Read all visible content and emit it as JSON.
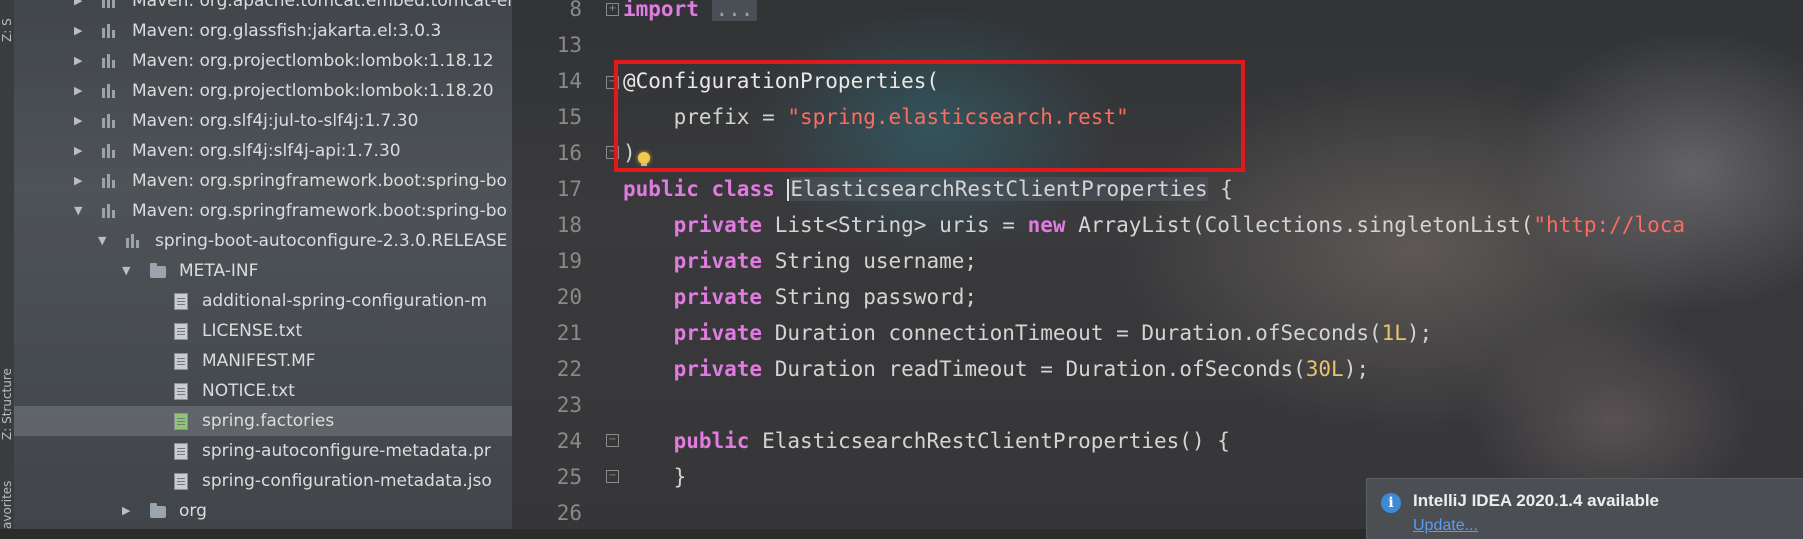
{
  "left_strip": {
    "top_label": "Z: S",
    "mid_label": "Z: Structure",
    "bottom_label": "avorites"
  },
  "project_tree": {
    "rows": [
      {
        "label": "Maven: org.apache.tomcat.embed:tomcat-em",
        "depth": 0,
        "expanded": false,
        "icon": "library-icon"
      },
      {
        "label": "Maven: org.glassfish:jakarta.el:3.0.3",
        "depth": 0,
        "expanded": false,
        "icon": "library-icon"
      },
      {
        "label": "Maven: org.projectlombok:lombok:1.18.12",
        "depth": 0,
        "expanded": false,
        "icon": "library-icon"
      },
      {
        "label": "Maven: org.projectlombok:lombok:1.18.20",
        "depth": 0,
        "expanded": false,
        "icon": "library-icon"
      },
      {
        "label": "Maven: org.slf4j:jul-to-slf4j:1.7.30",
        "depth": 0,
        "expanded": false,
        "icon": "library-icon"
      },
      {
        "label": "Maven: org.slf4j:slf4j-api:1.7.30",
        "depth": 0,
        "expanded": false,
        "icon": "library-icon"
      },
      {
        "label": "Maven: org.springframework.boot:spring-bo",
        "depth": 0,
        "expanded": false,
        "icon": "library-icon"
      },
      {
        "label": "Maven: org.springframework.boot:spring-bo",
        "depth": 0,
        "expanded": true,
        "icon": "library-icon"
      },
      {
        "label": "spring-boot-autoconfigure-2.3.0.RELEASE",
        "depth": 1,
        "expanded": true,
        "icon": "jar-icon"
      },
      {
        "label": "META-INF",
        "depth": 2,
        "expanded": true,
        "icon": "folder-icon"
      },
      {
        "label": "additional-spring-configuration-m",
        "depth": 3,
        "icon": "json-file-icon"
      },
      {
        "label": "LICENSE.txt",
        "depth": 3,
        "icon": "text-file-icon"
      },
      {
        "label": "MANIFEST.MF",
        "depth": 3,
        "icon": "manifest-file-icon"
      },
      {
        "label": "NOTICE.txt",
        "depth": 3,
        "icon": "text-file-icon"
      },
      {
        "label": "spring.factories",
        "depth": 3,
        "icon": "spring-file-icon",
        "selected": true
      },
      {
        "label": "spring-autoconfigure-metadata.pr",
        "depth": 3,
        "icon": "properties-file-icon"
      },
      {
        "label": "spring-configuration-metadata.jso",
        "depth": 3,
        "icon": "json-file-icon"
      },
      {
        "label": "org",
        "depth": 2,
        "expanded": false,
        "icon": "folder-icon"
      }
    ]
  },
  "editor": {
    "lines": [
      {
        "n": "8",
        "code": "import_line"
      },
      {
        "n": "13"
      },
      {
        "n": "14"
      },
      {
        "n": "15"
      },
      {
        "n": "16"
      },
      {
        "n": "17"
      },
      {
        "n": "18"
      },
      {
        "n": "19"
      },
      {
        "n": "20"
      },
      {
        "n": "21"
      },
      {
        "n": "22"
      },
      {
        "n": "23"
      },
      {
        "n": "24"
      },
      {
        "n": "25"
      },
      {
        "n": "26"
      }
    ],
    "tokens": {
      "import_kw": "import",
      "import_dots": "...",
      "annotation": "@ConfigurationProperties(",
      "prefix_key": "    prefix = ",
      "prefix_value": "\"spring.elasticsearch.rest\"",
      "close_paren": ")",
      "public_kw": "public",
      "class_kw": "class",
      "class_name": "ElasticsearchRestClientProperties",
      "open_brace": " {",
      "private_kw": "private",
      "uris_decl": " List<String> uris = ",
      "new_kw": "new",
      "uris_rest": " ArrayList(Collections.singletonList(",
      "uris_str": "\"http://loca",
      "username_decl": " String username;",
      "password_decl": " String password;",
      "conn_decl": " Duration connectionTimeout = Duration.ofSeconds(",
      "conn_num": "1L",
      "conn_end": ");",
      "read_decl": " Duration readTimeout = Duration.ofSeconds(",
      "read_num": "30L",
      "read_end": ");",
      "ctor_public": "public",
      "ctor_sig": " ElasticsearchRestClientProperties() {",
      "ctor_close": "}"
    }
  },
  "notification": {
    "title": "IntelliJ IDEA 2020.1.4 available",
    "link": "Update..."
  },
  "colors": {
    "keyword": "#e07be0",
    "string": "#ff6b5e",
    "number": "#e8c46a",
    "highlight_box": "#e01a1a",
    "link": "#589df6"
  }
}
